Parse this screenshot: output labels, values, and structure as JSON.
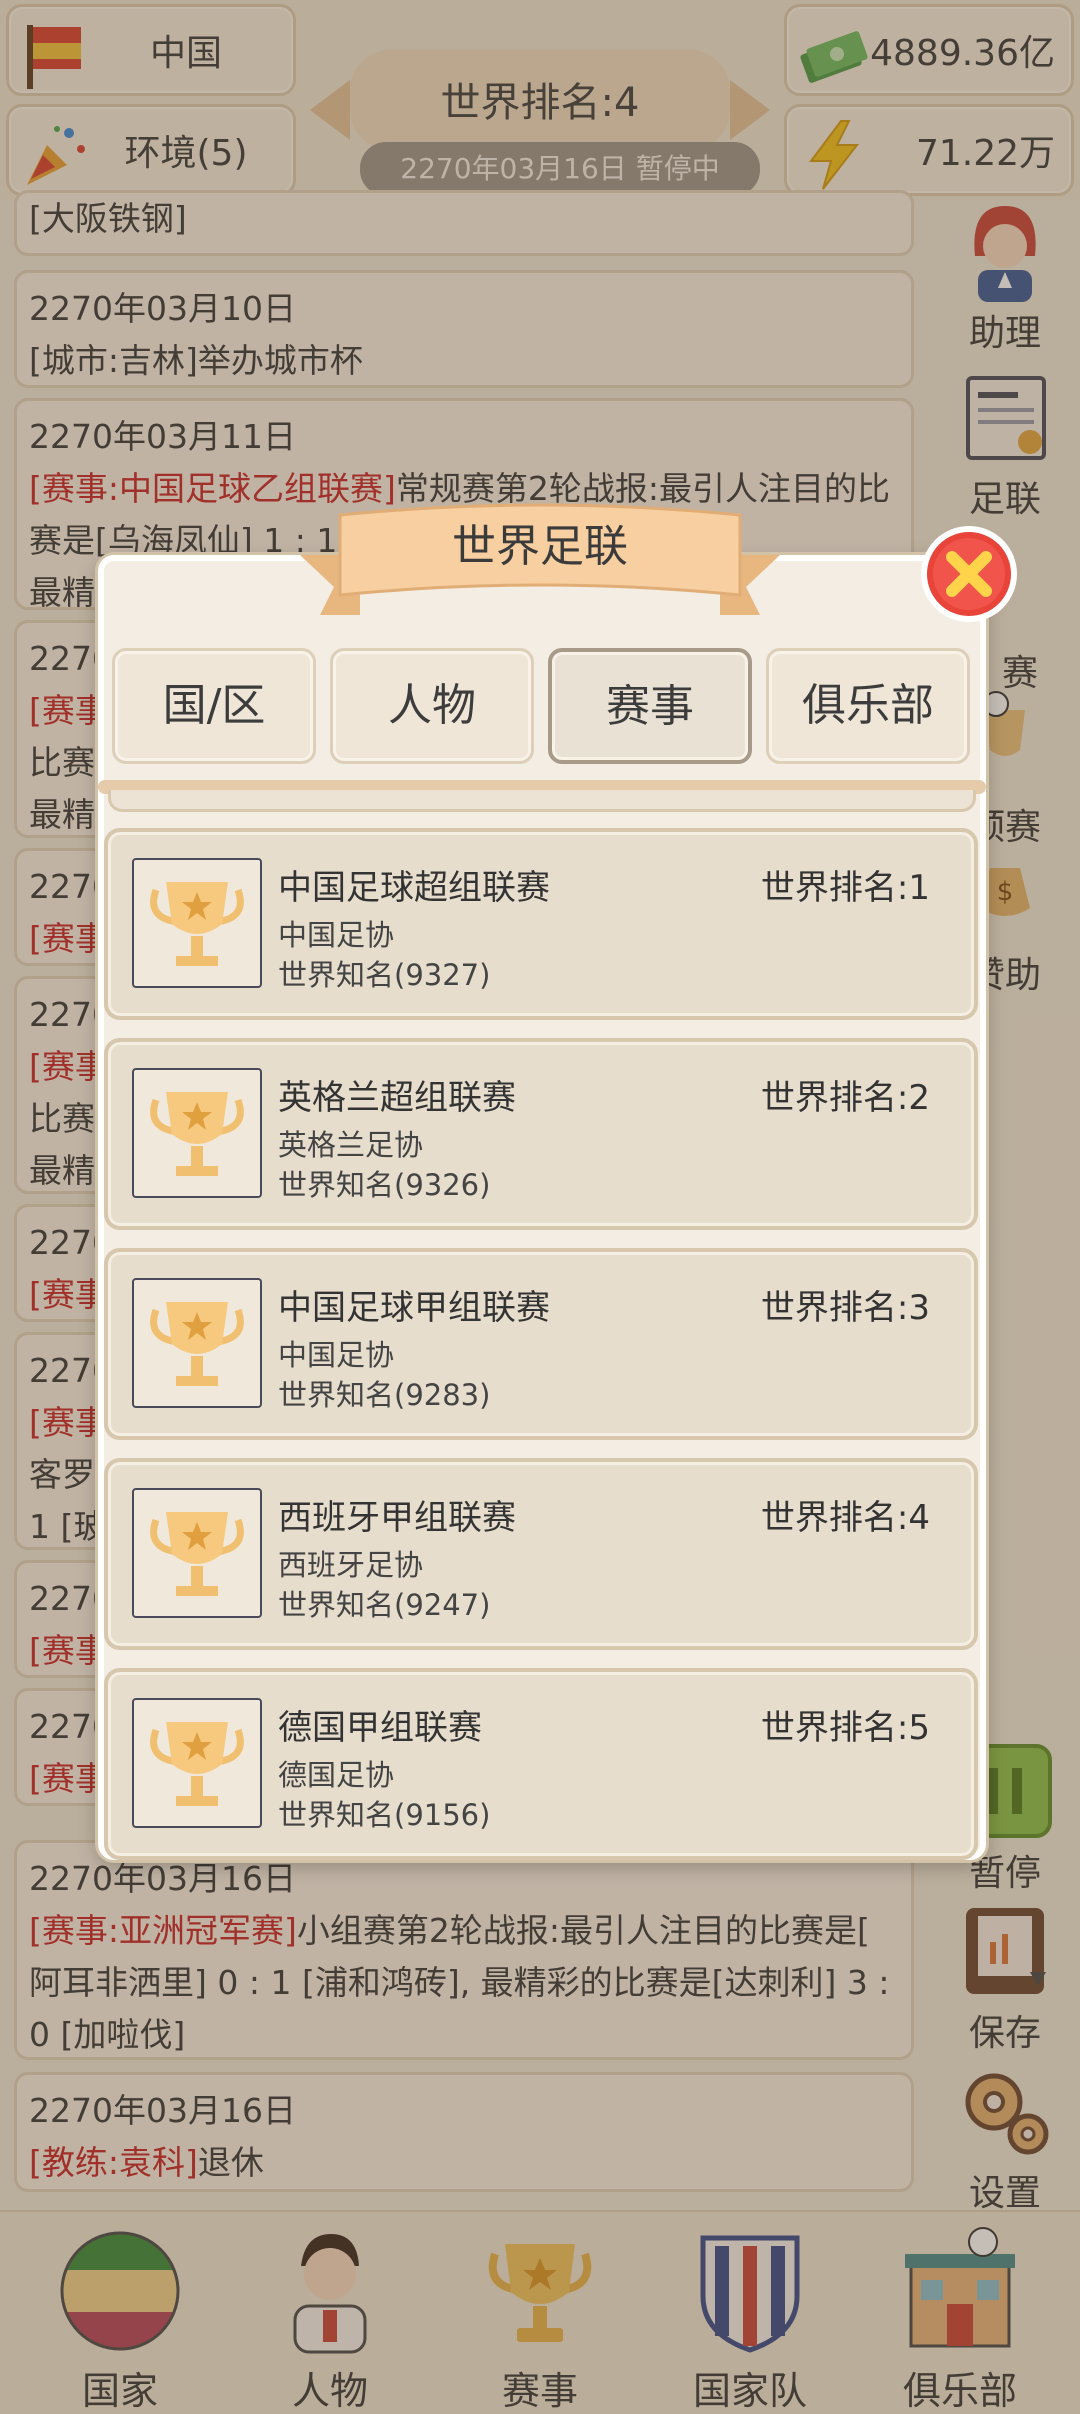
{
  "header": {
    "country": "中国",
    "environment": "环境(5)",
    "money": "4889.36亿",
    "energy": "71.22万",
    "world_rank": "世界排名:4",
    "date_status": "2270年03月16日 暂停中"
  },
  "feed": [
    {
      "lines": [
        {
          "text": "[大阪铁钢]",
          "red": false
        }
      ]
    },
    {
      "date": "2270年03月10日",
      "lines": [
        {
          "text": "[城市:吉林]举办城市杯",
          "red": false
        }
      ]
    },
    {
      "date": "2270年03月11日",
      "tag": "[赛事:中国足球乙组联赛]",
      "body": "常规赛第2轮战报:最引人注目的比赛是[乌海凤仙] 1 : 1",
      "body2": "最精"
    },
    {
      "date": "2270",
      "tag": "[赛事",
      "body": "",
      "body2": "比赛",
      "body3": "最精"
    },
    {
      "date": "2270",
      "tag": "[赛事"
    },
    {
      "date": "2270",
      "tag": "[赛事",
      "body2": "比赛",
      "body3": "最精"
    },
    {
      "date": "2270",
      "tag": "[赛事"
    },
    {
      "date": "2270",
      "tag": "[赛事",
      "body2": "客罗",
      "body3": "1 [玻"
    },
    {
      "date": "2270",
      "tag": "[赛事"
    },
    {
      "date": "2270",
      "tag": "[赛事"
    },
    {
      "date": "2270年03月16日",
      "tag": "[赛事:亚洲冠军赛]",
      "body": "小组赛第2轮战报:最引人注目的比赛是[",
      "body2": "阿耳非洒里] 0 : 1 [浦和鸿砖], 最精彩的比赛是[达刺利] 3 :",
      "body3": "0 [加啦伐]"
    },
    {
      "date": "2270年03月16日",
      "tag": "[教练:袁科]",
      "body": "退休"
    }
  ],
  "side_menu": {
    "assistant": "助理",
    "fifa": "足联",
    "match_frag": "赛",
    "prelim": "预赛",
    "sponsor_frag": "赞助",
    "pause": "暂停",
    "save": "保存",
    "settings": "设置"
  },
  "bottom_nav": {
    "country": "国家",
    "people": "人物",
    "events": "赛事",
    "national_team": "国家队",
    "clubs": "俱乐部"
  },
  "dialog": {
    "title": "世界足联",
    "tabs": [
      "国/区",
      "人物",
      "赛事",
      "俱乐部"
    ],
    "active_tab": "赛事",
    "competitions": [
      {
        "name": "中国足球超组联赛",
        "association": "中国足协",
        "fame": "世界知名(9327)",
        "rank": "世界排名:1"
      },
      {
        "name": "英格兰超组联赛",
        "association": "英格兰足协",
        "fame": "世界知名(9326)",
        "rank": "世界排名:2"
      },
      {
        "name": "中国足球甲组联赛",
        "association": "中国足协",
        "fame": "世界知名(9283)",
        "rank": "世界排名:3"
      },
      {
        "name": "西班牙甲组联赛",
        "association": "西班牙足协",
        "fame": "世界知名(9247)",
        "rank": "世界排名:4"
      },
      {
        "name": "德国甲组联赛",
        "association": "德国足协",
        "fame": "世界知名(9156)",
        "rank": "世界排名:5"
      }
    ]
  }
}
